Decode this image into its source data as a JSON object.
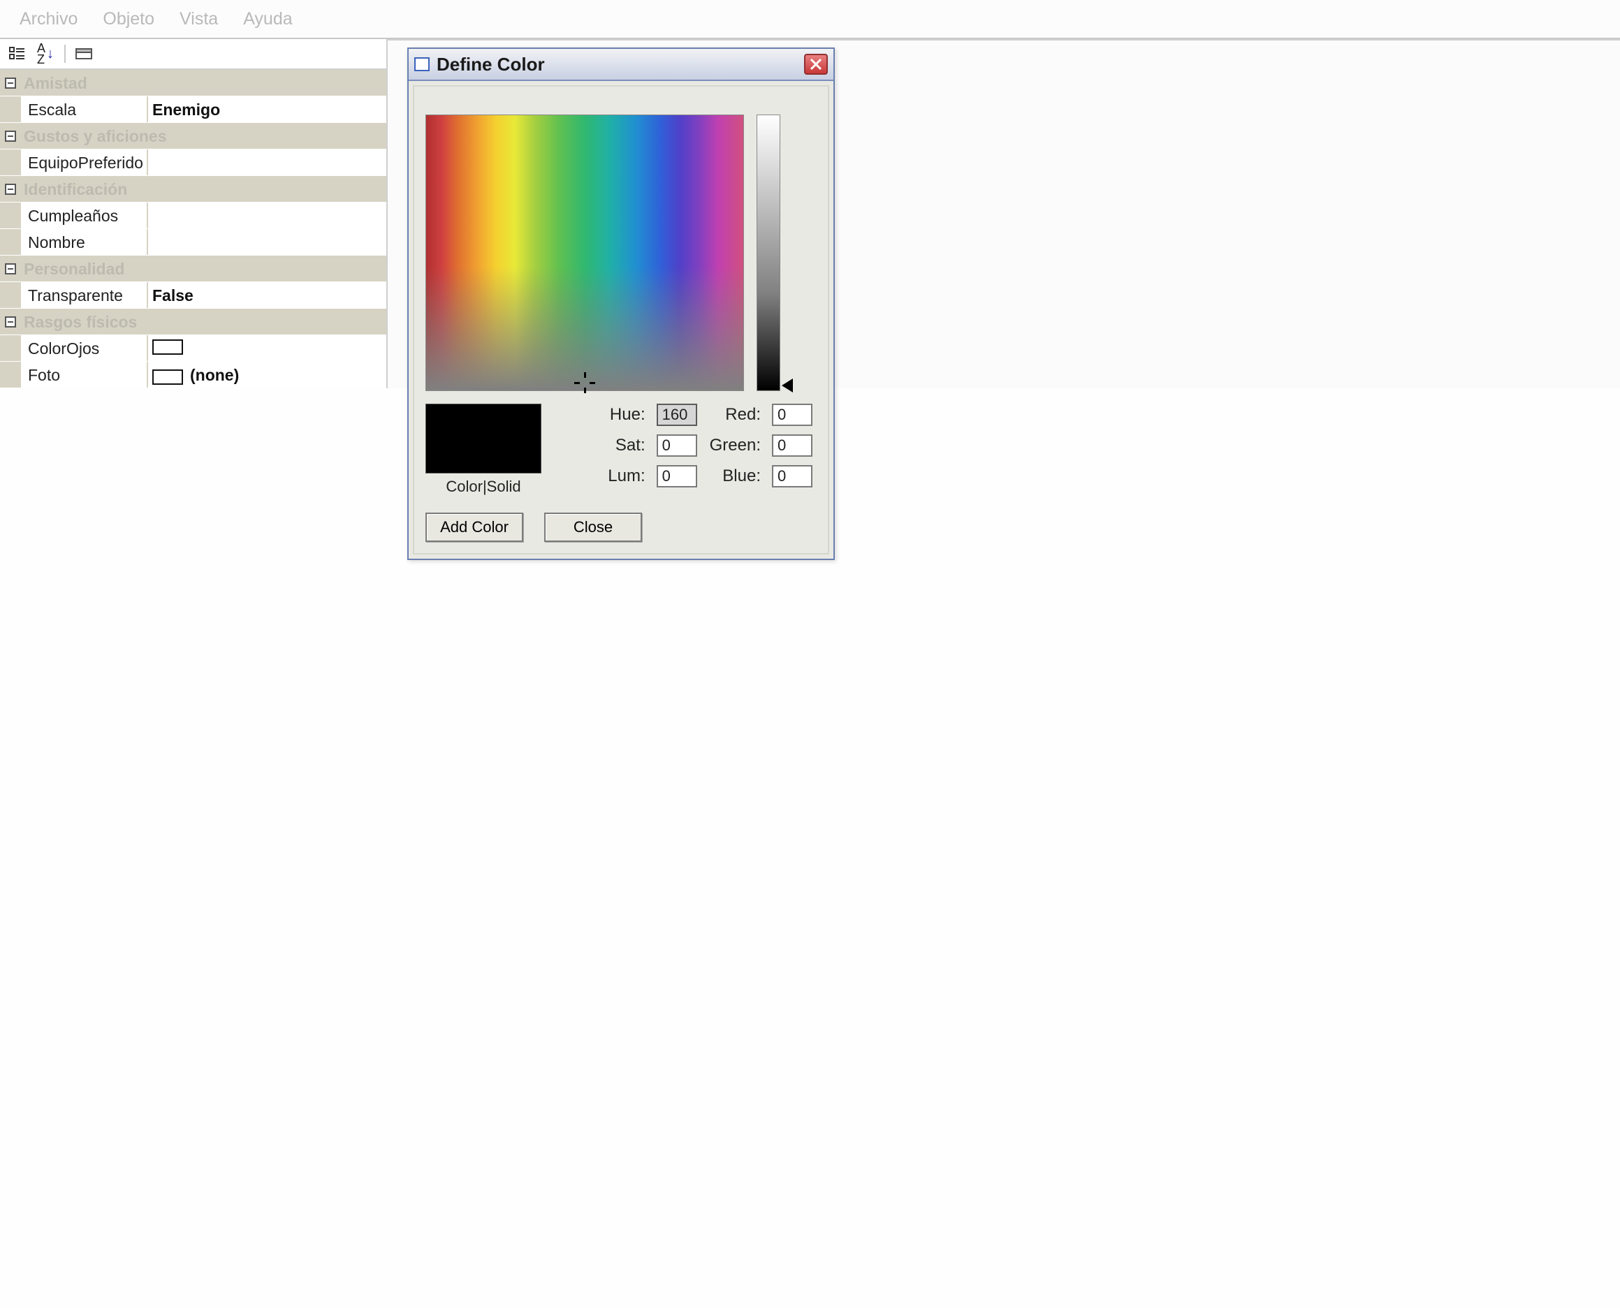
{
  "menu": {
    "items": [
      "Archivo",
      "Objeto",
      "Vista",
      "Ayuda"
    ]
  },
  "propgrid": {
    "categories": [
      {
        "name": "Amistad",
        "props": [
          {
            "label": "Escala",
            "value": "Enemigo"
          }
        ]
      },
      {
        "name": "Gustos y aficiones",
        "props": [
          {
            "label": "EquipoPreferido",
            "value": ""
          }
        ]
      },
      {
        "name": "Identificación",
        "props": [
          {
            "label": "Cumpleaños",
            "value": ""
          },
          {
            "label": "Nombre",
            "value": ""
          }
        ]
      },
      {
        "name": "Personalidad",
        "props": [
          {
            "label": "Transparente",
            "value": "False"
          }
        ]
      },
      {
        "name": "Rasgos físicos",
        "props": [
          {
            "label": "ColorOjos",
            "value": "",
            "swatch": "#ffffff"
          },
          {
            "label": "Foto",
            "value": "(none)",
            "swatch": "#ffffff"
          }
        ]
      }
    ]
  },
  "dialog": {
    "title": "Define Color",
    "preview_label": "Color|Solid",
    "preview_color": "#000000",
    "labels": {
      "hue": "Hue:",
      "sat": "Sat:",
      "lum": "Lum:",
      "red": "Red:",
      "green": "Green:",
      "blue": "Blue:"
    },
    "values": {
      "hue": "160",
      "sat": "0",
      "lum": "0",
      "red": "0",
      "green": "0",
      "blue": "0"
    },
    "buttons": {
      "add": "Add Color",
      "close": "Close"
    }
  }
}
